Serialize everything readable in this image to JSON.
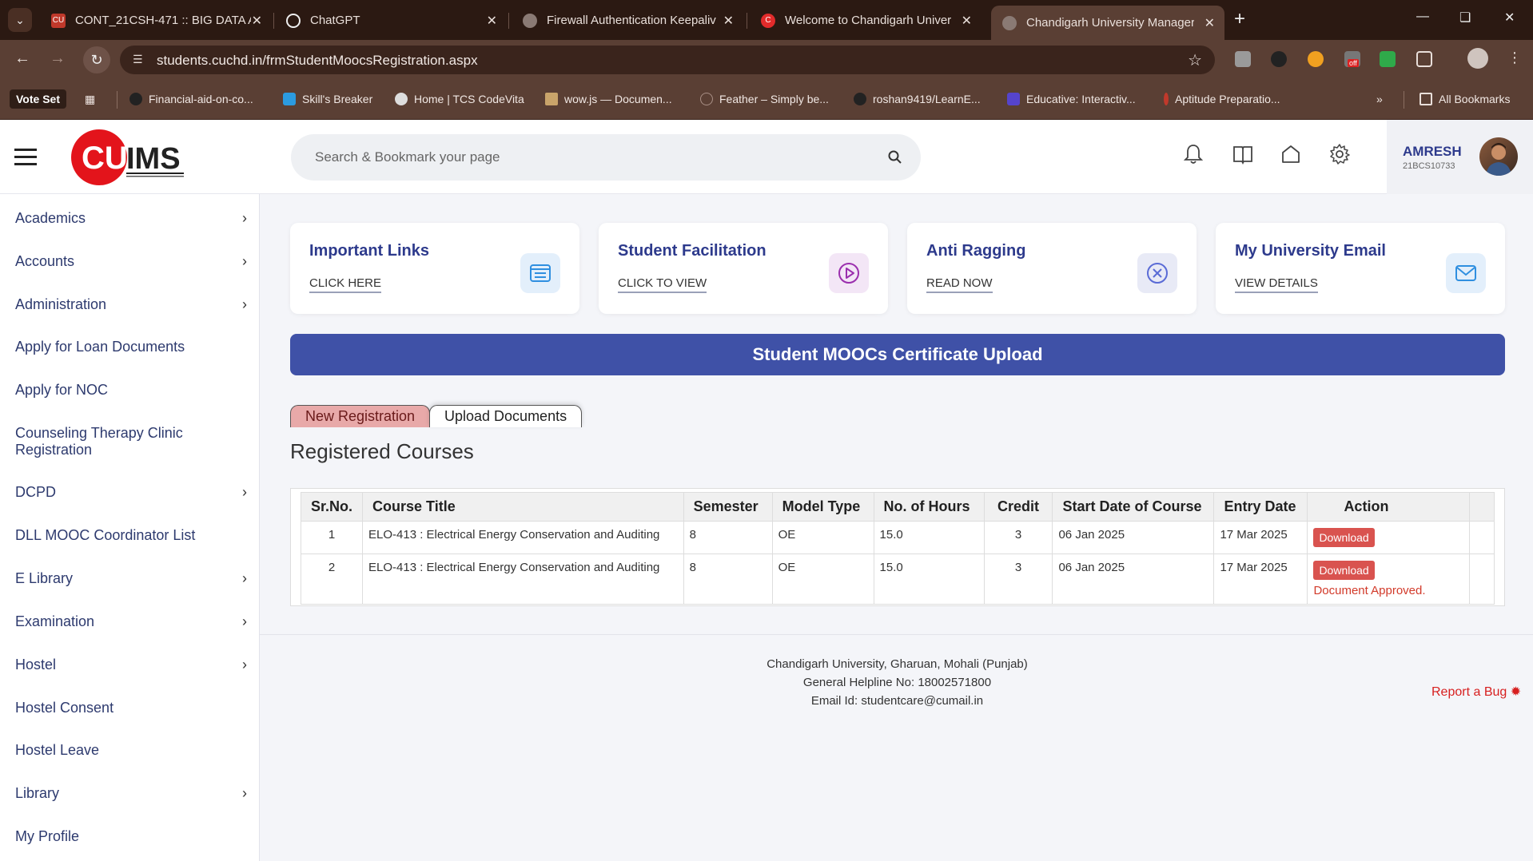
{
  "browser": {
    "tabs": [
      {
        "title": "CONT_21CSH-471 :: BIG DATA A",
        "active": false
      },
      {
        "title": "ChatGPT",
        "active": false
      },
      {
        "title": "Firewall Authentication Keepaliv",
        "active": false
      },
      {
        "title": "Welcome to Chandigarh Univer",
        "active": false
      },
      {
        "title": "Chandigarh University Manager",
        "active": true
      }
    ],
    "url": "students.cuchd.in/frmStudentMoocsRegistration.aspx",
    "bookmarks": [
      "Vote Set",
      "Financial-aid-on-co...",
      "Skill's Breaker",
      "Home | TCS CodeVita",
      "wow.js — Documen...",
      "Feather – Simply be...",
      "roshan9419/LearnE...",
      "Educative: Interactiv...",
      "Aptitude Preparatio..."
    ],
    "all_bookmarks": "All Bookmarks",
    "ext_badge": "off"
  },
  "header": {
    "logo_text": "CUIMS",
    "search_placeholder": "Search & Bookmark your page",
    "user_name": "AMRESH",
    "user_id": "21BCS10733"
  },
  "sidebar": {
    "items": [
      {
        "label": "Academics",
        "has_children": true
      },
      {
        "label": "Accounts",
        "has_children": true
      },
      {
        "label": "Administration",
        "has_children": true
      },
      {
        "label": "Apply for Loan Documents",
        "has_children": false
      },
      {
        "label": "Apply for NOC",
        "has_children": false
      },
      {
        "label": "Counseling Therapy Clinic",
        "label2": "Registration",
        "has_children": false
      },
      {
        "label": "DCPD",
        "has_children": true
      },
      {
        "label": "DLL MOOC Coordinator List",
        "has_children": false
      },
      {
        "label": "E Library",
        "has_children": true
      },
      {
        "label": "Examination",
        "has_children": true
      },
      {
        "label": "Hostel",
        "has_children": true
      },
      {
        "label": "Hostel Consent",
        "has_children": false
      },
      {
        "label": "Hostel Leave",
        "has_children": false
      },
      {
        "label": "Library",
        "has_children": true
      },
      {
        "label": "My Profile",
        "has_children": false
      }
    ]
  },
  "cards": [
    {
      "title": "Important Links",
      "link": "CLICK HERE",
      "icon": "list-icon",
      "color": "#2f8fe0"
    },
    {
      "title": "Student Facilitation",
      "link": "CLICK TO VIEW",
      "icon": "play-icon",
      "color": "#9b2fae"
    },
    {
      "title": "Anti Ragging",
      "link": "READ NOW",
      "icon": "close-circle-icon",
      "color": "#5a6bd6"
    },
    {
      "title": "My University Email",
      "link": "VIEW DETAILS",
      "icon": "mail-icon",
      "color": "#2f8fe0"
    }
  ],
  "banner": "Student MOOCs Certificate Upload",
  "tabs": {
    "new": "New Registration",
    "upload": "Upload Documents"
  },
  "section_title": "Registered Courses",
  "table": {
    "headers": [
      "Sr.No.",
      "Course Title",
      "Semester",
      "Model Type",
      "No. of Hours",
      "Credit",
      "Start Date of Course",
      "Entry Date",
      "Action"
    ],
    "rows": [
      {
        "sr": "1",
        "title": "ELO-413 : Electrical Energy Conservation and Auditing",
        "semester": "8",
        "model": "OE",
        "hours": "15.0",
        "credit": "3",
        "start": "06 Jan 2025",
        "entry": "17 Mar 2025",
        "action": "Download",
        "status": ""
      },
      {
        "sr": "2",
        "title": "ELO-413 : Electrical Energy Conservation and Auditing",
        "semester": "8",
        "model": "OE",
        "hours": "15.0",
        "credit": "3",
        "start": "06 Jan 2025",
        "entry": "17 Mar 2025",
        "action": "Download",
        "status": "Document Approved."
      }
    ]
  },
  "footer": {
    "line1": "Chandigarh University, Gharuan, Mohali (Punjab)",
    "line2": "General Helpline No: 18002571800",
    "line3": "Email Id: studentcare@cumail.in",
    "report": "Report a Bug"
  }
}
